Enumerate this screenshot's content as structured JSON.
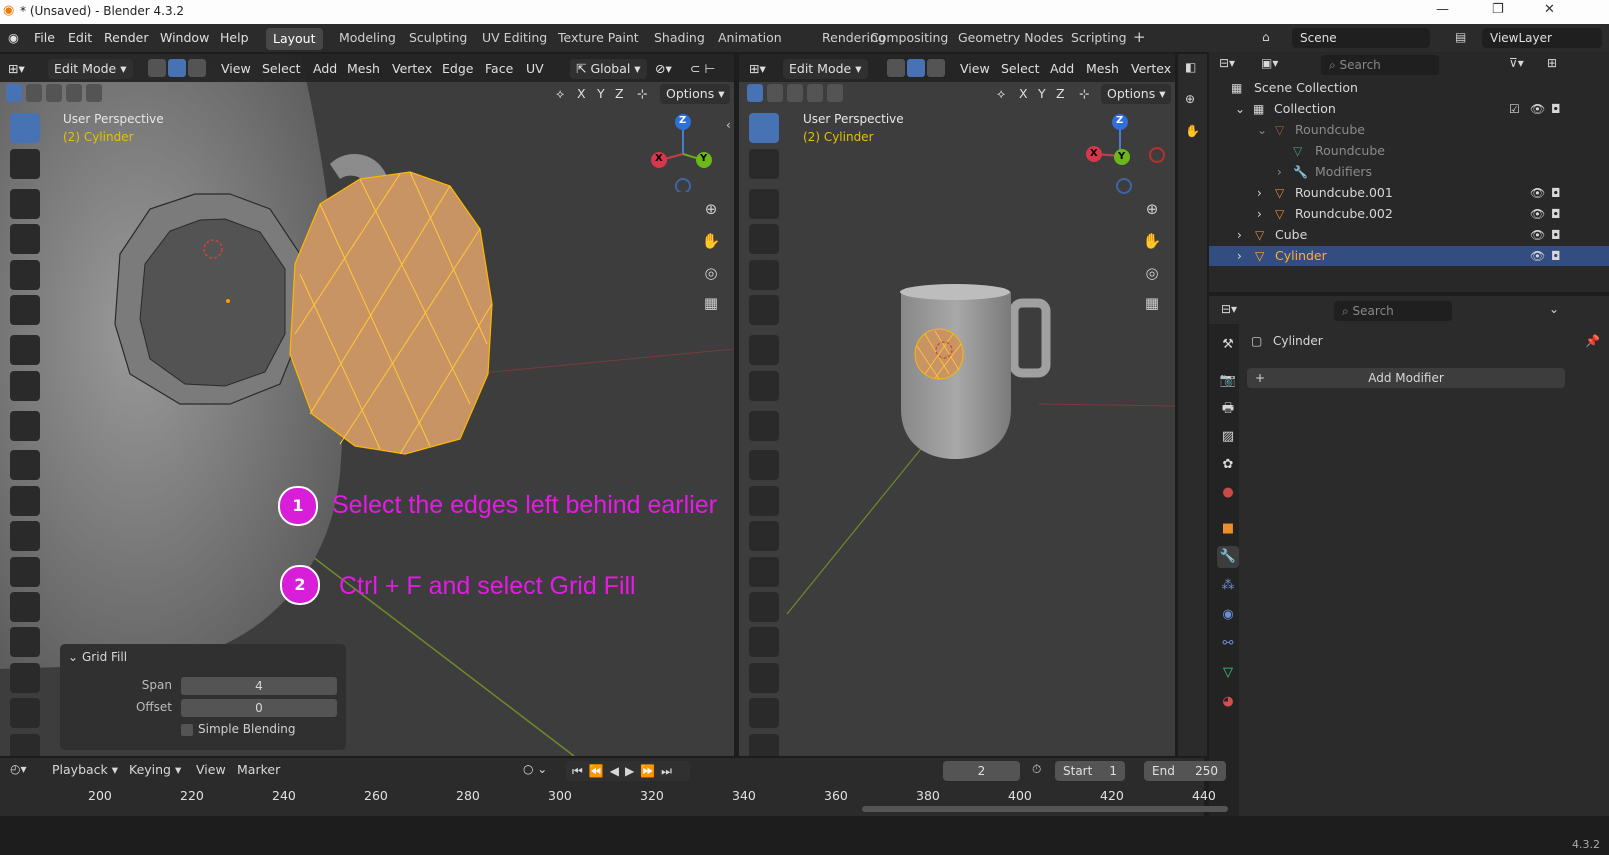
{
  "window": {
    "title": "* (Unsaved) - Blender 4.3.2"
  },
  "menu": [
    "File",
    "Edit",
    "Render",
    "Window",
    "Help"
  ],
  "workspaces": [
    "Layout",
    "Modeling",
    "Sculpting",
    "UV Editing",
    "Texture Paint",
    "Shading",
    "Animation",
    "Rendering",
    "Compositing",
    "Geometry Nodes",
    "Scripting"
  ],
  "scene": {
    "name": "Scene",
    "view_layer": "ViewLayer"
  },
  "viewport_left": {
    "mode": "Edit Mode",
    "menus": [
      "View",
      "Select",
      "Add",
      "Mesh",
      "Vertex",
      "Edge",
      "Face",
      "UV"
    ],
    "orientation": "Global",
    "axes": [
      "X",
      "Y",
      "Z"
    ],
    "options": "Options",
    "label": "User Perspective",
    "object": "(2) Cylinder",
    "gizmo": {
      "x": "X",
      "y": "Y",
      "z": "Z"
    }
  },
  "viewport_right": {
    "mode": "Edit Mode",
    "menus": [
      "View",
      "Select",
      "Add",
      "Mesh",
      "Vertex"
    ],
    "axes": [
      "X",
      "Y",
      "Z"
    ],
    "options": "Options",
    "label": "User Perspective",
    "object": "(2) Cylinder",
    "gizmo": {
      "x": "X",
      "y": "Y",
      "z": "Z"
    }
  },
  "annotations": [
    {
      "num": "1",
      "text": "Select the edges left behind earlier"
    },
    {
      "num": "2",
      "text": "Ctrl + F and select Grid Fill"
    }
  ],
  "gridfill_panel": {
    "title": "Grid Fill",
    "span_label": "Span",
    "span_value": "4",
    "offset_label": "Offset",
    "offset_value": "0",
    "simple_blending": "Simple Blending"
  },
  "outliner": {
    "search_placeholder": "Search",
    "scene_collection": "Scene Collection",
    "collection": "Collection",
    "items": [
      "Roundcube",
      "Roundcube",
      "Modifiers",
      "Roundcube.001",
      "Roundcube.002",
      "Cube",
      "Cylinder"
    ]
  },
  "properties": {
    "search_placeholder": "Search",
    "object_name": "Cylinder",
    "add_modifier": "Add Modifier"
  },
  "timeline": {
    "menus": [
      "Playback",
      "Keying",
      "View",
      "Marker"
    ],
    "current_frame": "2",
    "start_label": "Start",
    "start": "1",
    "end_label": "End",
    "end": "250",
    "ticks": [
      "200",
      "220",
      "240",
      "260",
      "280",
      "300",
      "320",
      "340",
      "360",
      "380",
      "400",
      "420",
      "440"
    ]
  },
  "version": "4.3.2",
  "colors": {
    "accent": "#4772b3",
    "selection": "#ffd23c",
    "annotation": "#e61ae6"
  }
}
